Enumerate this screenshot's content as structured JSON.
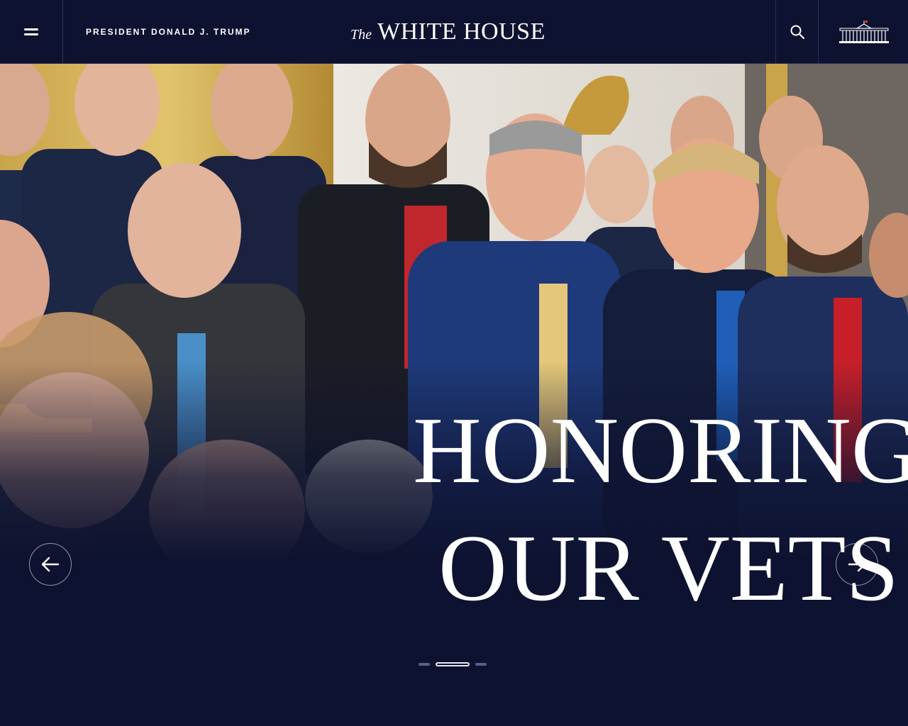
{
  "header": {
    "menu_icon": "hamburger-menu-icon",
    "president_label": "PRESIDENT DONALD J. TRUMP",
    "logo_prefix": "The",
    "logo_main": "WHITE HOUSE",
    "search_icon": "search-icon",
    "emblem_icon": "white-house-building-icon"
  },
  "hero": {
    "headline_line1": "HONORING",
    "headline_line2": "OUR VETS",
    "prev_icon": "arrow-left-icon",
    "next_icon": "arrow-right-icon",
    "slides_count": 3,
    "active_slide": 2
  },
  "colors": {
    "navy": "#0d1230",
    "white": "#ffffff",
    "dot_inactive": "#5a607e"
  }
}
